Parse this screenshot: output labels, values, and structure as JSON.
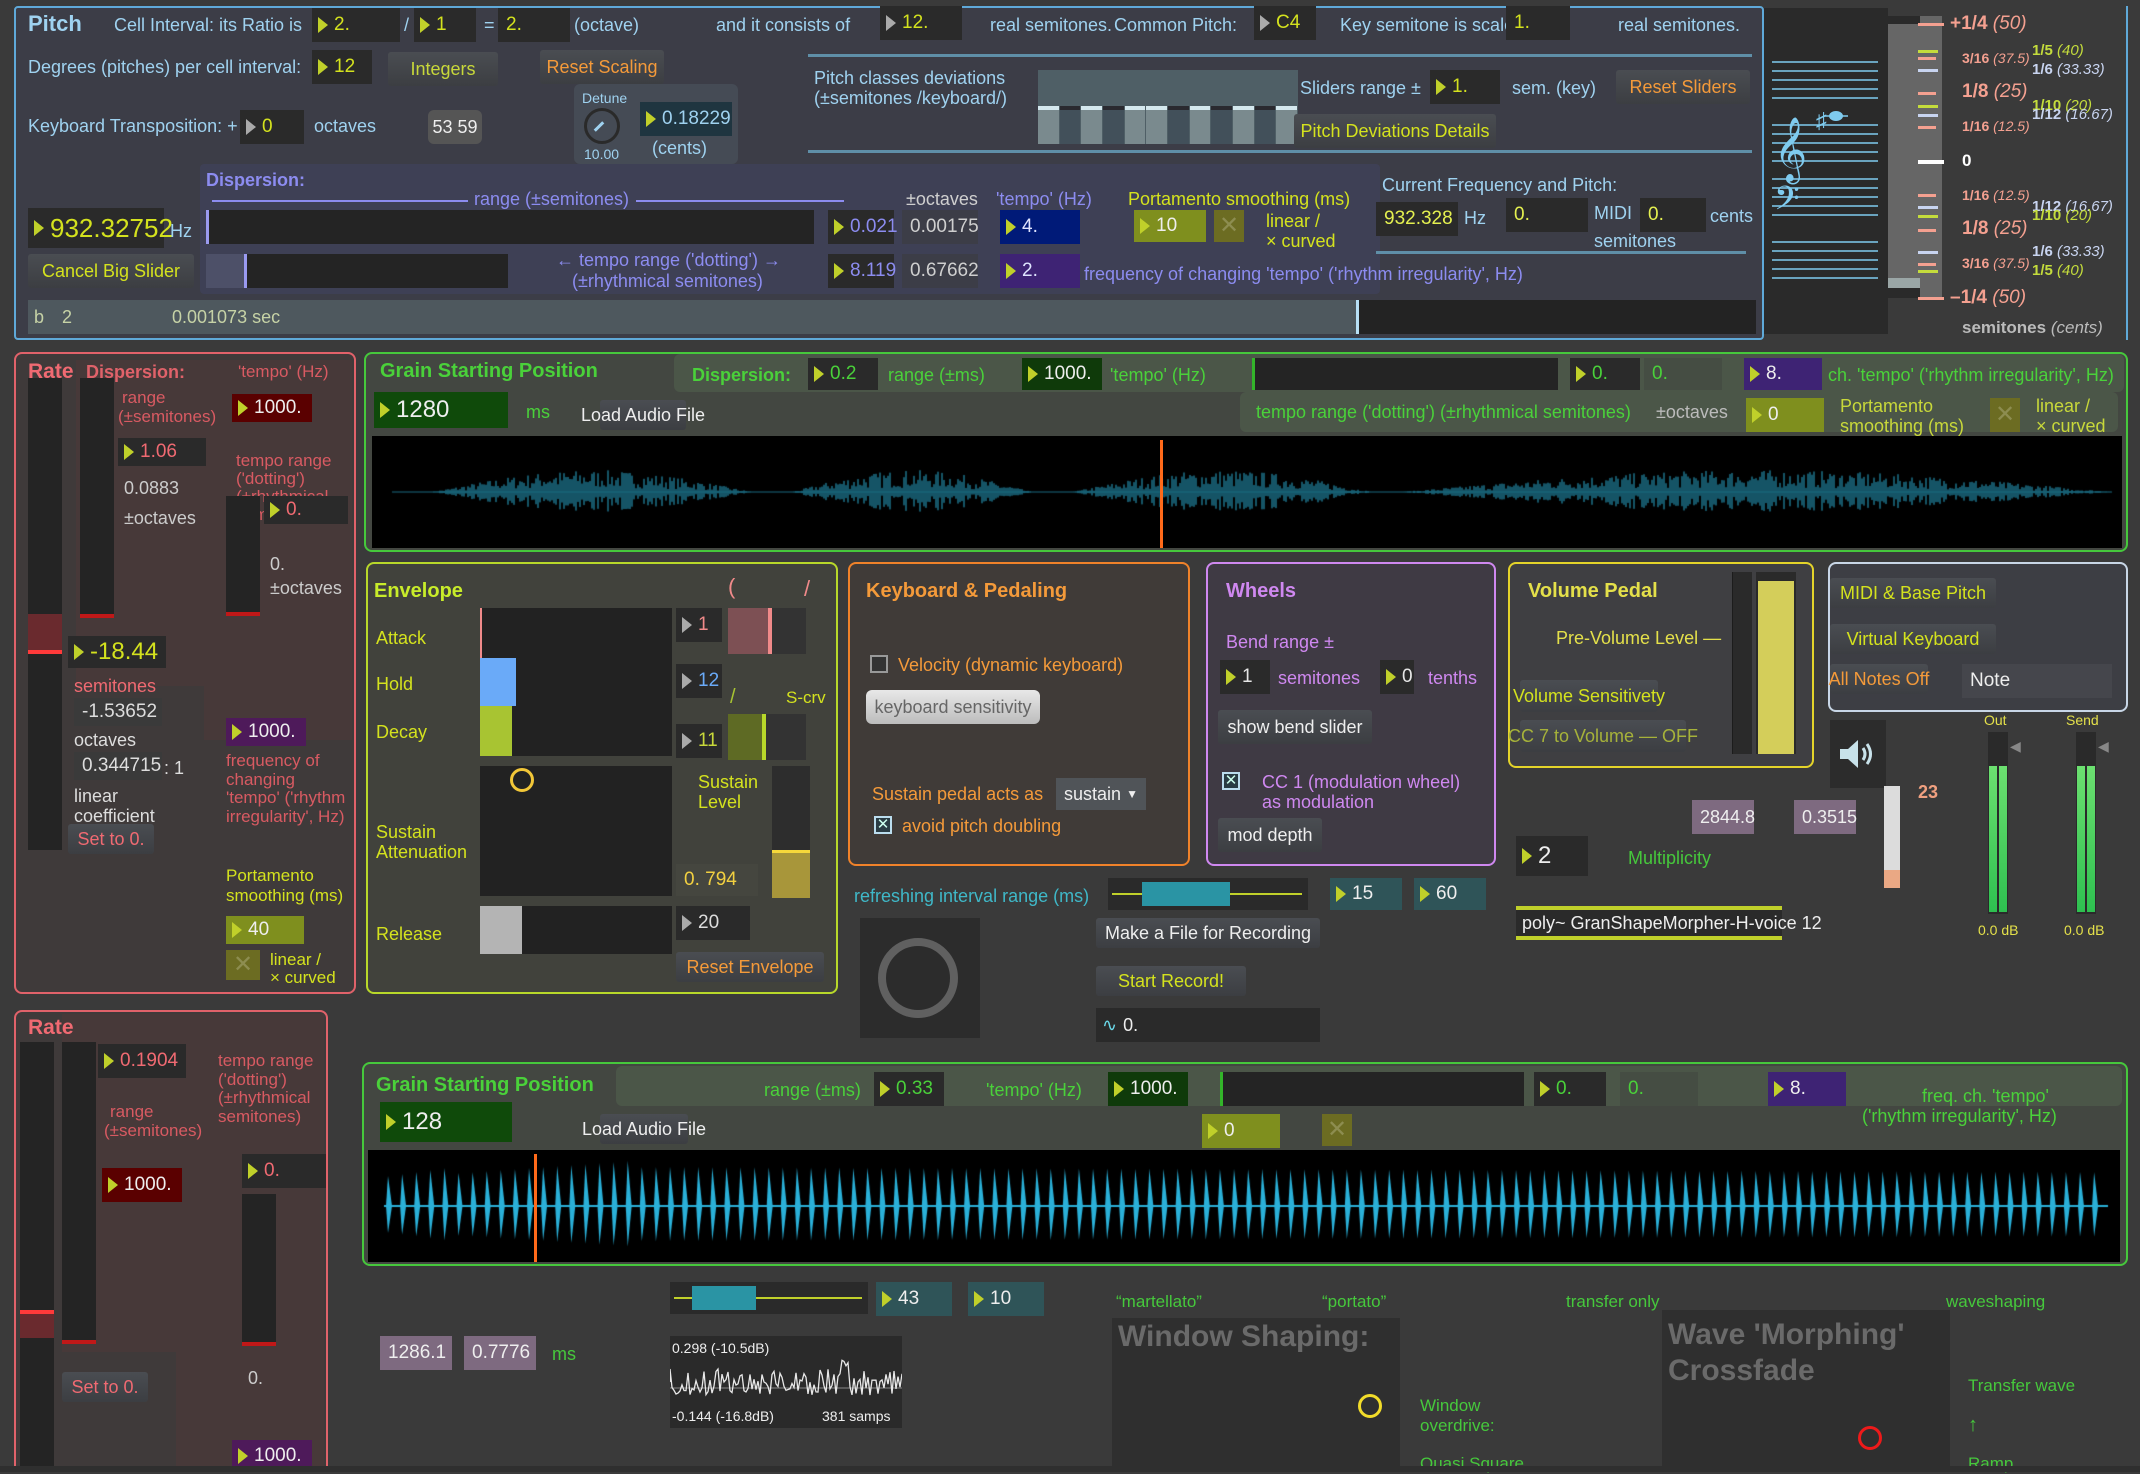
{
  "pitch": {
    "title": "Pitch",
    "cell_interval_label": "Cell Interval: its Ratio is",
    "ratio_num": "2.",
    "ratio_sep": "/",
    "ratio_den": "1",
    "ratio_eq": "=",
    "ratio_result": "2.",
    "ratio_name": "(octave)",
    "consists_label": "and it consists of",
    "consists_value": "12.",
    "real_semitones": "real semitones.",
    "common_pitch_label": "Common Pitch:",
    "common_pitch_value": "C4",
    "key_scaled_label": "Key semitone is scaled to",
    "key_scaled_value": "1.",
    "key_scaled_unit": "real semitones.",
    "degrees_label": "Degrees (pitches) per cell interval:",
    "degrees_value": "12",
    "integers_button": "Integers",
    "reset_scaling_button": "Reset Scaling",
    "transposition_label": "Keyboard Transposition: +",
    "transposition_value": "0",
    "transposition_unit": "octaves",
    "notes_display": "53 59",
    "detune_label": "Detune",
    "detune_knob_value": "10.00",
    "detune_value": "0.18229",
    "detune_unit": "(cents)",
    "deviations_label_1": "Pitch classes deviations",
    "deviations_label_2": "(±semitones /keyboard/)",
    "sliders_range_label": "Sliders range  ±",
    "sliders_range_value": "1.",
    "sliders_range_unit": "sem. (key)",
    "reset_sliders_button": "Reset Sliders",
    "deviations_details_button": "Pitch Deviations Details",
    "frequency_value": "932.32752",
    "frequency_unit": "Hz",
    "cancel_big_slider_button": "Cancel Big Slider",
    "dispersion": {
      "title": "Dispersion:",
      "range_label": "range (±semitones)",
      "tempo_range_label_1": "← tempo range ('dotting') →",
      "tempo_range_label_2": "(±rhythmical semitones)",
      "range_value": "0.021",
      "range_octaves": "0.00175",
      "tempo_range_value": "8.119",
      "tempo_range_octaves": "0.67662",
      "octaves_header": "±octaves",
      "tempo_header": "'tempo' (Hz)",
      "tempo_value": "4.",
      "freq_change_value": "2.",
      "freq_change_label": "frequency of changing 'tempo' ('rhythm irregularity', Hz)",
      "portamento_label": "Portamento smoothing (ms)",
      "portamento_value": "10",
      "curve_label_1": "linear /",
      "curve_label_2": "× curved"
    },
    "current": {
      "title": "Current Frequency and Pitch:",
      "hz_value": "932.328",
      "hz_unit": "Hz",
      "midi_value": "0.",
      "midi_label": "MIDI",
      "semitones_label": "semitones",
      "cents_value": "0.",
      "cents_label": "cents"
    },
    "status": {
      "b_label": "b",
      "b_value": "2",
      "time": "0.001073 sec"
    }
  },
  "tuning_scale": {
    "marks": [
      {
        "label": "+1/4",
        "cents": "(50)",
        "color": "#f4a090"
      },
      {
        "label": "3/16",
        "cents": "(37.5)",
        "color": "#f4a090"
      },
      {
        "label": "1/8",
        "cents": "(25)",
        "color": "#f4a090"
      },
      {
        "label": "1/16",
        "cents": "(12.5)",
        "color": "#f4a090"
      },
      {
        "label": "0",
        "cents": "",
        "color": "#ffffff"
      },
      {
        "label": "1/16",
        "cents": "(12.5)",
        "color": "#f4a090"
      },
      {
        "label": "1/8",
        "cents": "(25)",
        "color": "#f4a090"
      },
      {
        "label": "3/16",
        "cents": "(37.5)",
        "color": "#f4a090"
      },
      {
        "label": "–1/4",
        "cents": "(50)",
        "color": "#f4a090"
      }
    ],
    "side_marks_top": [
      {
        "label": "1/5",
        "cents": "(40)",
        "color": "#c4dc3c"
      },
      {
        "label": "1/6",
        "cents": "(33.33)",
        "color": "#c8d4f0"
      },
      {
        "label": "1/10",
        "cents": "(20)",
        "color": "#c4dc3c"
      },
      {
        "label": "1/12",
        "cents": "(16.67)",
        "color": "#c8d4f0"
      }
    ],
    "side_marks_bottom": [
      {
        "label": "1/12",
        "cents": "(16.67)",
        "color": "#c8d4f0"
      },
      {
        "label": "1/10",
        "cents": "(20)",
        "color": "#c4dc3c"
      },
      {
        "label": "1/6",
        "cents": "(33.33)",
        "color": "#c8d4f0"
      },
      {
        "label": "1/5",
        "cents": "(40)",
        "color": "#c4dc3c"
      }
    ],
    "footer_bold": "semitones",
    "footer_italic": "(cents)"
  },
  "rate1": {
    "title": "Rate",
    "dispersion_title": "Dispersion:",
    "range_label_1": "range",
    "range_label_2": "(±semitones)",
    "range_value": "1.06",
    "range_octaves": "0.0883",
    "octaves_label": "±octaves",
    "tempo_label": "'tempo' (Hz)",
    "tempo_value": "1000.",
    "tempo_range_label": [
      "tempo range",
      "('dotting')",
      "(±rhythmical",
      "semitones)"
    ],
    "tempo_range_value": "0.",
    "tempo_range_octaves": "0.",
    "tempo_range_octaves_label": "±octaves",
    "semitones_value": "-18.44",
    "semitones_label": "semitones",
    "octaves_value": "-1.53652",
    "octaves_unit": "octaves",
    "coef_value": "0.344715",
    "coef_ratio": ": 1",
    "coef_label_1": "linear",
    "coef_label_2": "coefficient",
    "freq_change_value": "1000.",
    "freq_change_label": [
      "frequency of",
      "changing",
      "'tempo' ('rhythm",
      "irregularity', Hz)"
    ],
    "portamento_label_1": "Portamento",
    "portamento_label_2": "smoothing (ms)",
    "portamento_value": "40",
    "curve_label_1": "linear /",
    "curve_label_2": "× curved",
    "set_zero_button": "Set to 0."
  },
  "grain1": {
    "title": "Grain Starting Position",
    "value": "1280",
    "unit": "ms",
    "load_button": "Load Audio File",
    "dispersion_label": "Dispersion:",
    "range_value": "0.2",
    "range_label": "range (±ms)",
    "tempo_value": "1000.",
    "tempo_label": "'tempo' (Hz)",
    "tempo_range_value": "0.",
    "tempo_range_octaves": "0.",
    "freq_change_value": "8.",
    "freq_change_label": "ch. 'tempo' ('rhythm irregularity', Hz)",
    "tempo_range_label": "tempo range ('dotting') (±rhythmical semitones)",
    "octaves_label": "±octaves",
    "portamento_value": "0",
    "portamento_label_1": "Portamento",
    "portamento_label_2": "smoothing (ms)",
    "curve_label_1": "linear /",
    "curve_label_2": "× curved",
    "playhead_position": 0.45
  },
  "envelope": {
    "title": "Envelope",
    "attack_label": "Attack",
    "attack_value": "1",
    "hold_label": "Hold",
    "hold_value": "12",
    "decay_label": "Decay",
    "decay_value": "11",
    "curve_scrv": "S-crv",
    "sustain_att_label_1": "Sustain",
    "sustain_att_label_2": "Attenuation",
    "sustain_level_label_1": "Sustain",
    "sustain_level_label_2": "Level",
    "sustain_level_value": "0. 794",
    "sustain_level": 0.36,
    "release_label": "Release",
    "release_value": "20",
    "reset_button": "Reset Envelope",
    "attack_color": "#f08a8a",
    "hold_color": "#6aaaf8",
    "decay_color": "#a8c432"
  },
  "keyboard": {
    "title": "Keyboard & Pedaling",
    "velocity_label": "Velocity (dynamic keyboard)",
    "velocity_checked": false,
    "sensitivity_button": "keyboard sensitivity",
    "sustain_label": "Sustain pedal acts as",
    "sustain_option": "sustain",
    "avoid_doubling_label": "avoid pitch doubling",
    "avoid_doubling_checked": true
  },
  "wheels": {
    "title": "Wheels",
    "bend_label": "Bend range ±",
    "bend_semitones": "1",
    "semitones_label": "semitones",
    "bend_tenths": "0",
    "tenths_label": "tenths",
    "show_bend_button": "show bend slider",
    "cc1_label_1": "CC 1 (modulation wheel)",
    "cc1_label_2": "as modulation",
    "cc1_checked": true,
    "mod_depth_button": "mod depth"
  },
  "volume_pedal": {
    "title": "Volume Pedal",
    "pre_volume_label": "Pre-Volume Level —",
    "sensitivity_button": "Volume Sensitivety",
    "cc7_button": "CC 7 to Volume — OFF",
    "level": 0.95
  },
  "midi_panel": {
    "midi_base_button": "MIDI & Base Pitch",
    "virtual_keyboard_button": "Virtual Keyboard",
    "all_notes_off_button": "All Notes Off",
    "note_display": "Note"
  },
  "output": {
    "speaker_number": "23",
    "value_a": "2844.8",
    "value_b": "0.3515",
    "multiplicity_value": "2",
    "multiplicity_label": "Multiplicity",
    "poly_object": "poly~ GranShapeMorpher-H-voice 12",
    "out_label": "Out",
    "send_label": "Send",
    "out_db": "0.0 dB",
    "send_db": "0.0 dB",
    "volume_slider": 0.18
  },
  "refresh": {
    "label": "refreshing interval range (ms)",
    "min_value": "15",
    "max_value": "60",
    "make_file_button": "Make a File for Recording",
    "start_record_button": "Start Record!",
    "signal_value": "0."
  },
  "rate2": {
    "title": "Rate",
    "range_value": "0.1904",
    "range_label_1": "range",
    "range_label_2": "(±semitones)",
    "tempo_value": "1000.",
    "tempo_range_label": [
      "tempo range",
      "('dotting')",
      "(±rhythmical",
      "semitones)"
    ],
    "tempo_range_value": "0.",
    "tempo_range_octaves": "0.",
    "set_zero_button": "Set to 0.",
    "freq_change_value": "1000."
  },
  "grain2": {
    "title": "Grain Starting Position",
    "value": "128",
    "load_button": "Load Audio File",
    "range_label": "range (±ms)",
    "range_value": "0.33",
    "tempo_label": "'tempo' (Hz)",
    "tempo_value": "1000.",
    "tempo_range_value": "0.",
    "tempo_range_octaves": "0.",
    "freq_change_value": "8.",
    "freq_change_label_1": "freq. ch. 'tempo'",
    "freq_change_label_2": "('rhythm irregularity', Hz)",
    "portamento_value": "0",
    "playhead_position": 0.095
  },
  "bottom": {
    "value_a": "1286.1",
    "value_b": "0.7776",
    "unit": "ms",
    "range_min": "43",
    "range_max": "10",
    "scope_top": "0.298 (-10.5dB)",
    "scope_bottom": "-0.144 (-16.8dB)",
    "scope_samps": "381 samps",
    "martellato": "“martellato”",
    "portato": "“portato”",
    "transfer_only": "transfer only",
    "waveshaping": "waveshaping",
    "window_shaping_title": "Window Shaping:",
    "window_overdrive_1": "Window",
    "window_overdrive_2": "overdrive:",
    "quasi_square": "Quasi Square",
    "wave_morph_title_1": "Wave 'Morphing'",
    "wave_morph_title_2": "Crossfade",
    "transfer_wave": "Transfer wave",
    "arrow": "↑",
    "ramp": "Ramp"
  }
}
